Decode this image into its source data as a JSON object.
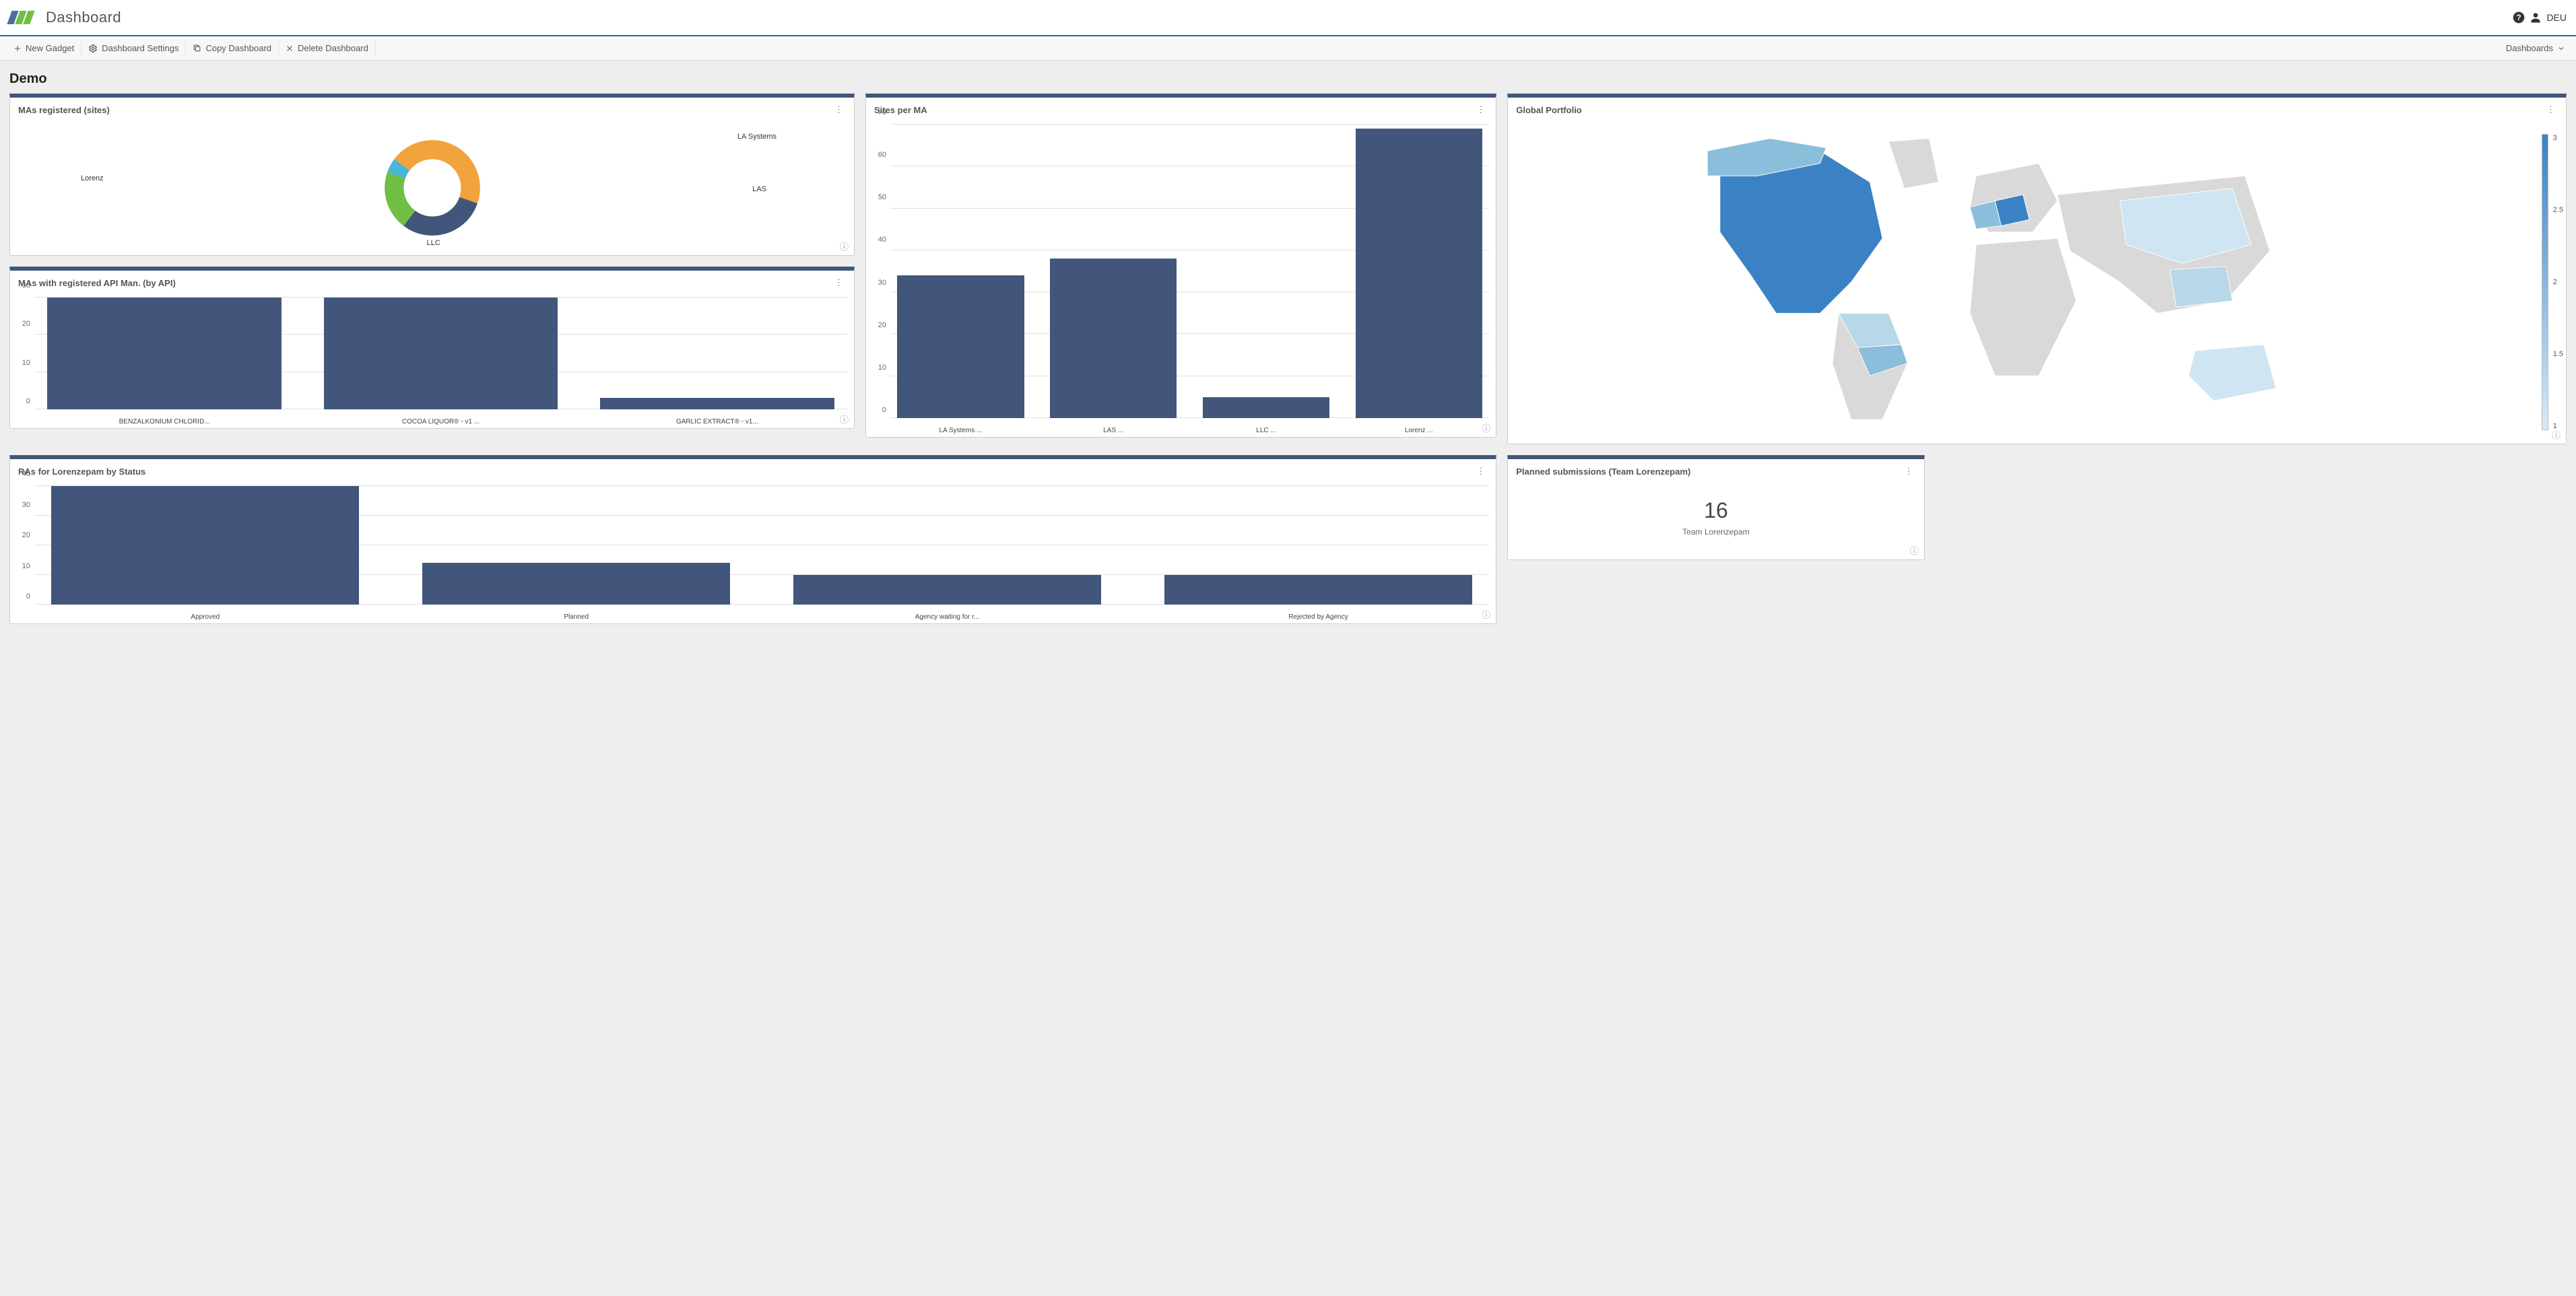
{
  "header": {
    "app_title": "Dashboard",
    "user_label": "DEU",
    "help_icon": "help-circle-icon",
    "user_icon": "user-icon"
  },
  "toolbar": {
    "new_gadget": "New Gadget",
    "settings": "Dashboard Settings",
    "copy": "Copy Dashboard",
    "delete": "Delete Dashboard",
    "dashboards_menu": "Dashboards"
  },
  "page_title": "Demo",
  "gadgets": {
    "donut": {
      "title": "MAs registered (sites)",
      "labels": {
        "top_right": "LA Systems",
        "right": "LAS",
        "bottom": "LLC",
        "left": "Lorenz"
      }
    },
    "api_bar": {
      "title": "MAs with registered API Man. (by API)"
    },
    "sites_bar": {
      "title": "Sites per MA"
    },
    "map": {
      "title": "Global Portfolio"
    },
    "ra_bar": {
      "title": "RAs for Lorenzepam by Status"
    },
    "planned": {
      "title": "Planned submissions (Team Lorenzepam)",
      "value": "16",
      "subtitle": "Team Lorenzepam"
    }
  },
  "chart_data": [
    {
      "id": "donut",
      "type": "pie",
      "title": "MAs registered (sites)",
      "series": [
        {
          "name": "LA Systems",
          "value": 30,
          "color": "#42567b"
        },
        {
          "name": "LAS",
          "value": 20,
          "color": "#6fbf44"
        },
        {
          "name": "LLC",
          "value": 5,
          "color": "#49b6d6"
        },
        {
          "name": "Lorenz",
          "value": 45,
          "color": "#f1a33c"
        }
      ]
    },
    {
      "id": "api_bar",
      "type": "bar",
      "title": "MAs with registered API Man. (by API)",
      "ylim": [
        0,
        30
      ],
      "y_ticks": [
        0,
        10,
        20,
        30
      ],
      "categories": [
        "BENZALKONIUM CHLORID...",
        "COCOA LIQUOR® - v1 ...",
        "GARLIC EXTRACT® - v1..."
      ],
      "values": [
        30,
        30,
        3
      ]
    },
    {
      "id": "sites_bar",
      "type": "bar",
      "title": "Sites per MA",
      "ylim": [
        0,
        70
      ],
      "y_ticks": [
        0,
        10,
        20,
        30,
        40,
        50,
        60,
        70
      ],
      "categories": [
        "LA Systems ...",
        "LAS ...",
        "LLC ...",
        "Lorenz ..."
      ],
      "values": [
        34,
        38,
        5,
        69
      ]
    },
    {
      "id": "map",
      "type": "heatmap",
      "title": "Global Portfolio",
      "legend_ticks": [
        "3",
        "2.5",
        "2",
        "1.5",
        "1"
      ],
      "colorscale": [
        "#d6eaf7",
        "#3b82c4"
      ]
    },
    {
      "id": "ra_bar",
      "type": "bar",
      "title": "RAs for Lorenzepam by Status",
      "ylim": [
        0,
        40
      ],
      "y_ticks": [
        0,
        10,
        20,
        30,
        40
      ],
      "categories": [
        "Approved",
        "Planned",
        "Agency waiting for r...",
        "Rejected by Agency"
      ],
      "values": [
        42,
        14,
        10,
        10
      ]
    }
  ]
}
